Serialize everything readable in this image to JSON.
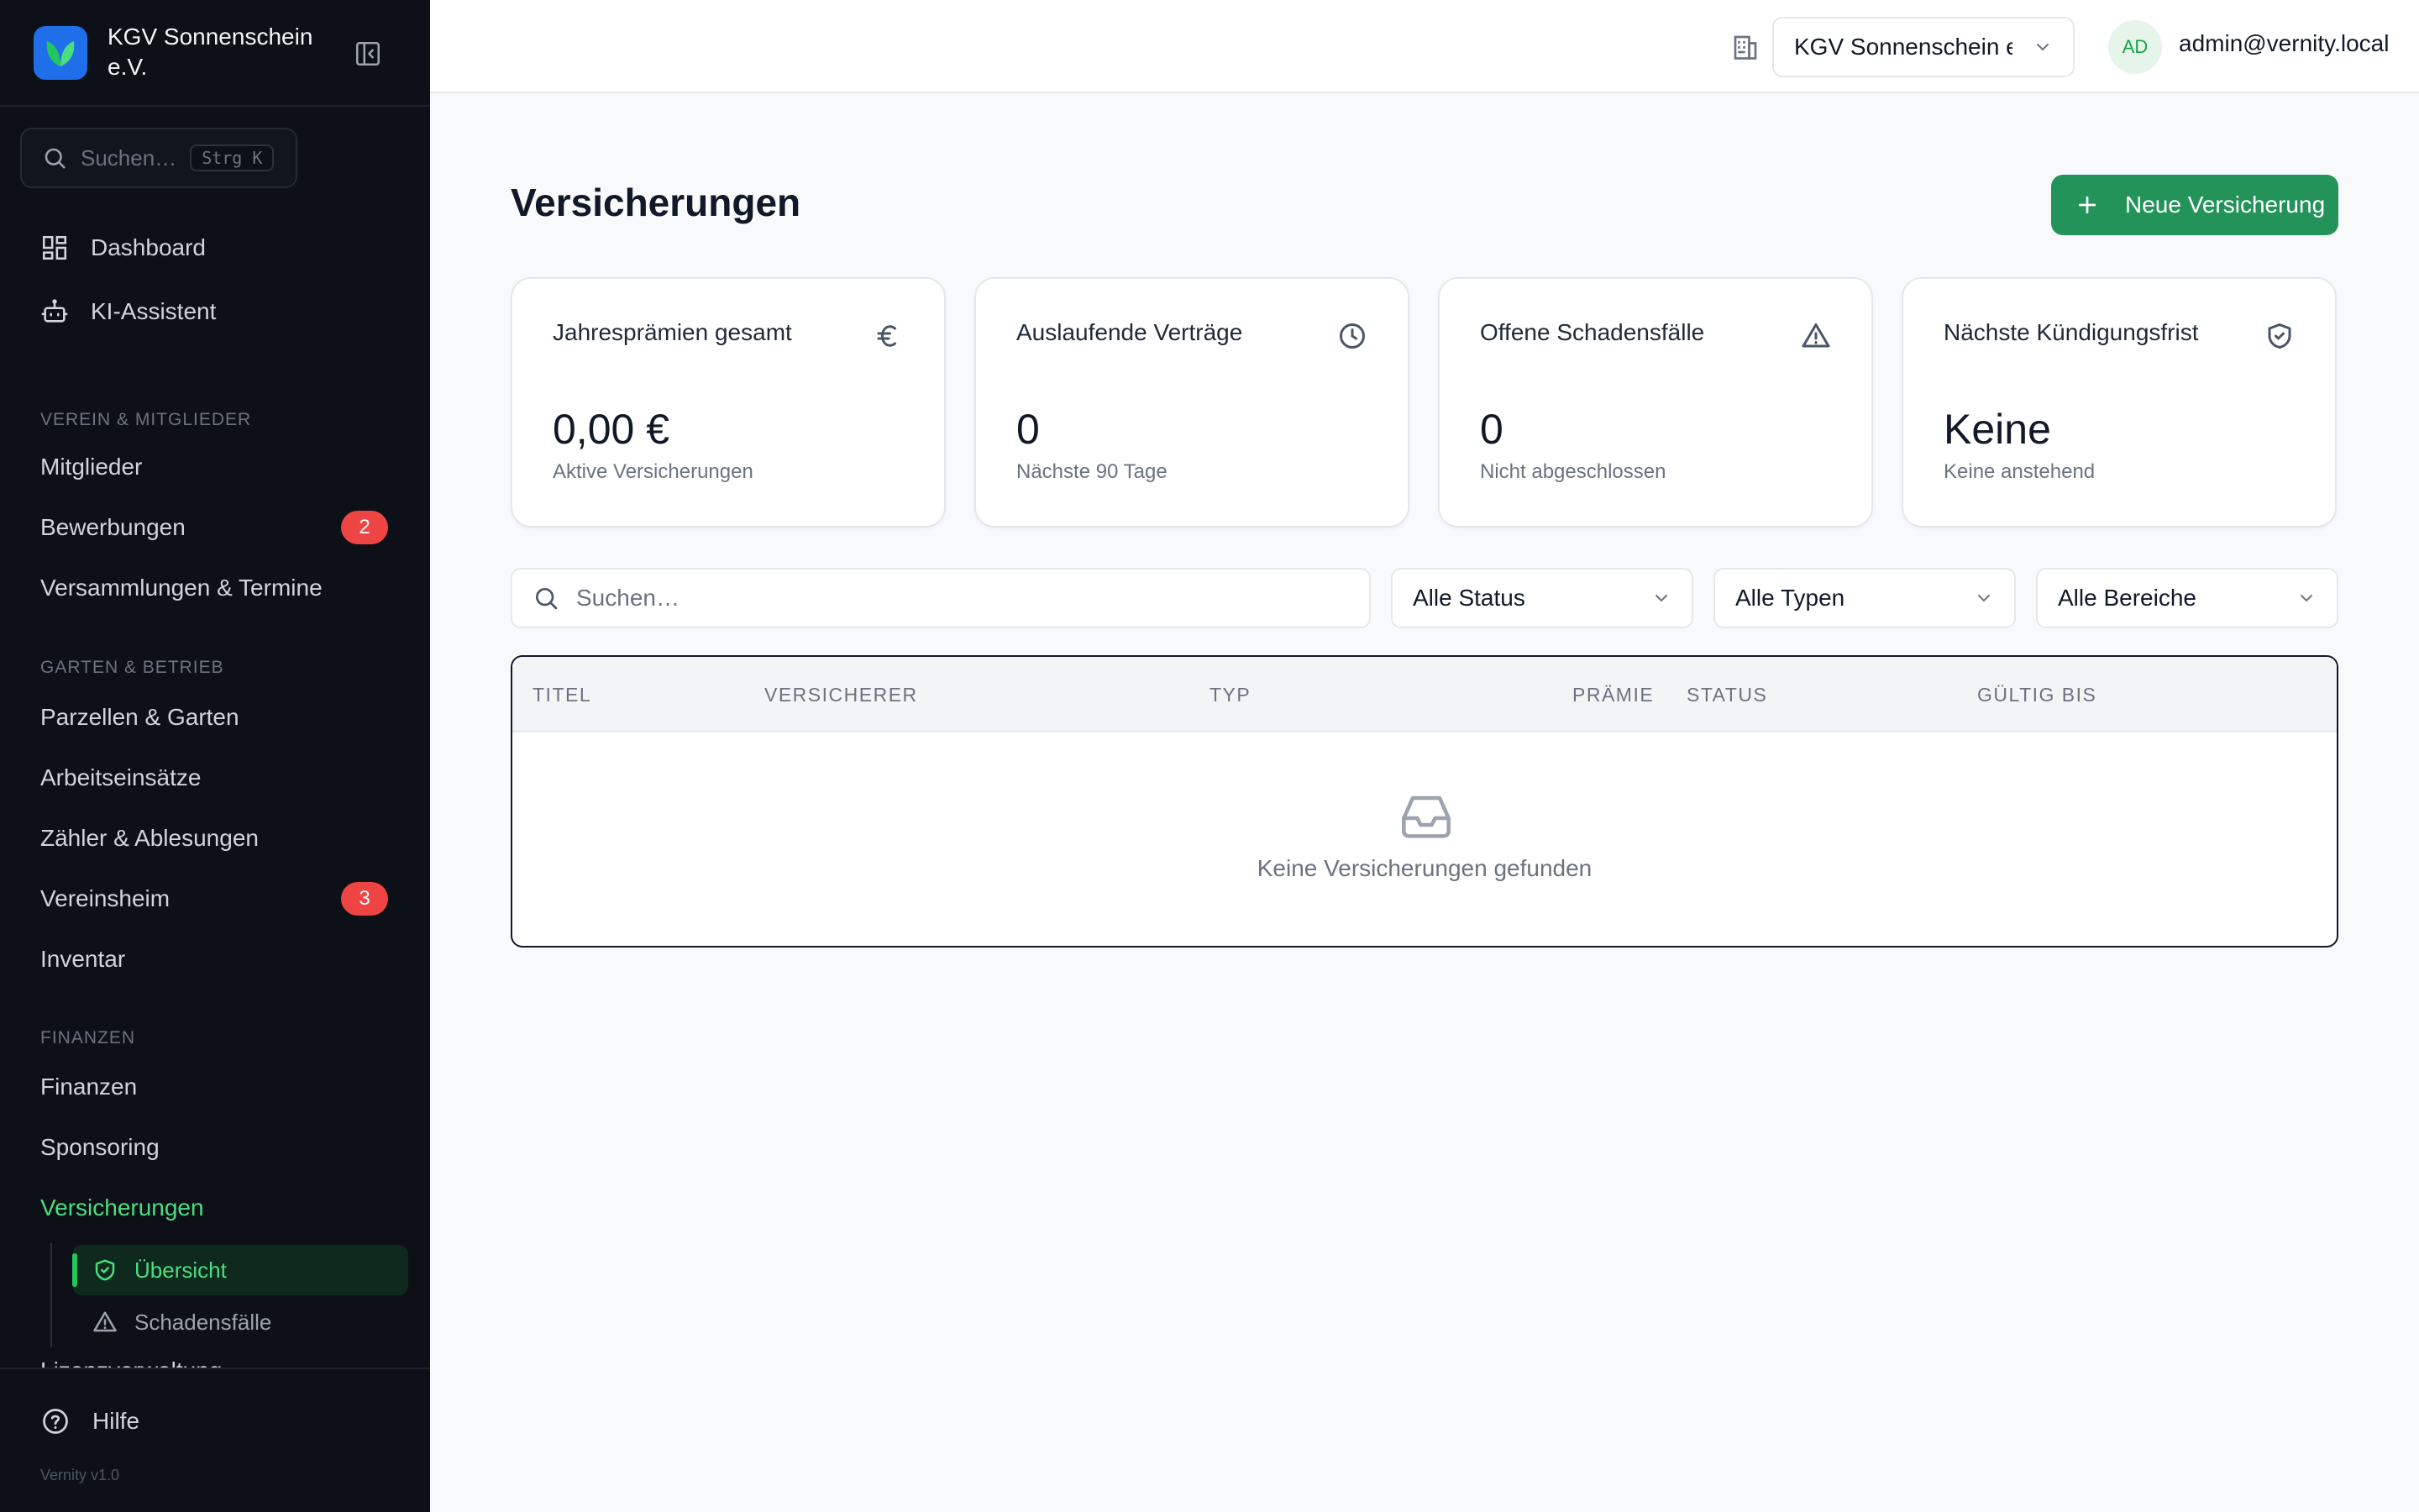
{
  "sidebar": {
    "org_name": "KGV Sonnenschein e.V.",
    "search_placeholder": "Suchen…",
    "search_shortcut": "Strg K",
    "top_items": [
      {
        "label": "Dashboard",
        "icon": "dashboard-icon"
      },
      {
        "label": "KI-Assistent",
        "icon": "robot-icon"
      }
    ],
    "sections": [
      {
        "title": "Verein & Mitglieder",
        "items": [
          {
            "label": "Mitglieder"
          },
          {
            "label": "Bewerbungen",
            "badge": "2"
          },
          {
            "label": "Versammlungen & Termine"
          }
        ]
      },
      {
        "title": "Garten & Betrieb",
        "items": [
          {
            "label": "Parzellen & Garten"
          },
          {
            "label": "Arbeitseinsätze"
          },
          {
            "label": "Zähler & Ablesungen"
          },
          {
            "label": "Vereinsheim",
            "badge": "3"
          },
          {
            "label": "Inventar"
          }
        ]
      },
      {
        "title": "Finanzen",
        "items": [
          {
            "label": "Finanzen"
          },
          {
            "label": "Sponsoring"
          },
          {
            "label": "Versicherungen",
            "active": true
          }
        ]
      }
    ],
    "sub_items": [
      {
        "label": "Übersicht",
        "icon": "shield-check-icon",
        "active": true
      },
      {
        "label": "Schadensfälle",
        "icon": "warning-icon"
      }
    ],
    "peek_item": "Lizenzverwaltung",
    "help_label": "Hilfe",
    "version": "Vernity v1.0"
  },
  "topbar": {
    "org_select_value": "KGV Sonnenschein e.V.",
    "avatar_initials": "AD",
    "user_email": "admin@vernity.local"
  },
  "main": {
    "title": "Versicherungen",
    "new_button": "Neue Versicherung",
    "cards": [
      {
        "title": "Jahresprämien gesamt",
        "icon": "euro-icon",
        "value": "0,00 €",
        "sub": "Aktive Versicherungen"
      },
      {
        "title": "Auslaufende Verträge",
        "icon": "clock-icon",
        "value": "0",
        "sub": "Nächste 90 Tage"
      },
      {
        "title": "Offene Schadensfälle",
        "icon": "warning-icon",
        "value": "0",
        "sub": "Nicht abgeschlossen"
      },
      {
        "title": "Nächste Kündigungsfrist",
        "icon": "shield-check-icon",
        "value": "Keine",
        "sub": "Keine anstehend"
      }
    ],
    "search_placeholder": "Suchen…",
    "filters": [
      "Alle Status",
      "Alle Typen",
      "Alle Bereiche"
    ],
    "table": {
      "columns": [
        "Titel",
        "Versicherer",
        "Typ",
        "Prämie",
        "Status",
        "Gültig bis"
      ],
      "empty_text": "Keine Versicherungen gefunden"
    }
  },
  "colors": {
    "sidebar_bg": "#0d1117",
    "accent_green": "#23935a",
    "active_green": "#4ade80",
    "badge_red": "#ef4444",
    "logo_blue": "#1f6feb"
  }
}
